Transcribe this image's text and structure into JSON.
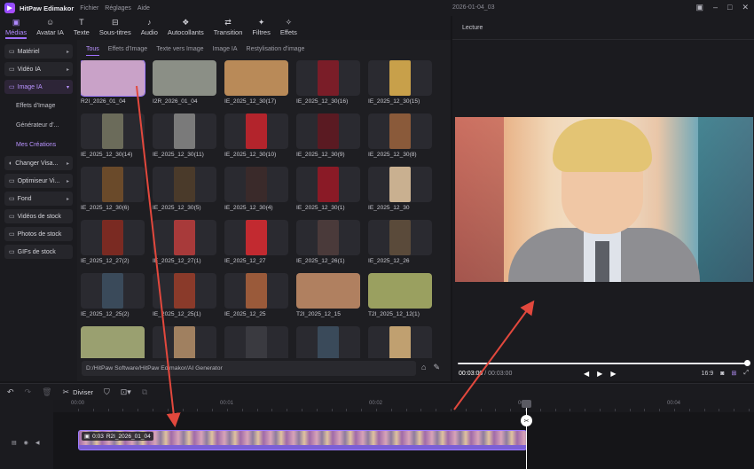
{
  "app": {
    "name": "HitPaw Edimakor",
    "menu": [
      "Fichier",
      "Réglages",
      "Aide"
    ],
    "project_title": "2026-01-04_03"
  },
  "toolbar": [
    {
      "label": "Médias",
      "icon": "media-icon",
      "glyph": "▣",
      "active": true
    },
    {
      "label": "Avatar IA",
      "icon": "avatar-icon",
      "glyph": "☺",
      "active": false
    },
    {
      "label": "Texte",
      "icon": "text-icon",
      "glyph": "T",
      "active": false
    },
    {
      "label": "Sous-titres",
      "icon": "subtitles-icon",
      "glyph": "⊟",
      "active": false
    },
    {
      "label": "Audio",
      "icon": "audio-icon",
      "glyph": "♪",
      "active": false
    },
    {
      "label": "Autocollants",
      "icon": "sticker-icon",
      "glyph": "❖",
      "active": false
    },
    {
      "label": "Transition",
      "icon": "transition-icon",
      "glyph": "⇄",
      "active": false
    },
    {
      "label": "Filtres",
      "icon": "filter-icon",
      "glyph": "✦",
      "active": false
    },
    {
      "label": "Effets",
      "icon": "effects-icon",
      "glyph": "✧",
      "active": false
    }
  ],
  "sidebar": {
    "groups": [
      {
        "label": "Matériel",
        "glyph": "▭",
        "active": false
      },
      {
        "label": "Vidéo IA",
        "glyph": "▭",
        "active": false
      },
      {
        "label": "Image IA",
        "glyph": "▭",
        "active": true
      }
    ],
    "sub_items": [
      {
        "label": "Effets d'Image",
        "active": false
      },
      {
        "label": "Générateur d'...",
        "active": false
      },
      {
        "label": "Mes Créations",
        "active": true
      }
    ],
    "more_groups": [
      {
        "label": "Changer Visa...",
        "glyph": "◐",
        "chev": true
      },
      {
        "label": "Optimiseur Vi...",
        "glyph": "▭",
        "chev": true
      },
      {
        "label": "Fond",
        "glyph": "▭",
        "chev": true
      },
      {
        "label": "Vidéos de stock",
        "glyph": "▭",
        "chev": false
      },
      {
        "label": "Photos de stock",
        "glyph": "▭",
        "chev": false
      },
      {
        "label": "GIFs de stock",
        "glyph": "▭",
        "chev": false
      }
    ]
  },
  "media": {
    "tabs": [
      {
        "label": "Tous",
        "active": true
      },
      {
        "label": "Effets d'Image",
        "active": false
      },
      {
        "label": "Texte vers Image",
        "active": false
      },
      {
        "label": "Image IA",
        "active": false
      },
      {
        "label": "Restylisation d'image",
        "active": false
      }
    ],
    "items": [
      {
        "name": "R2I_2026_01_04",
        "color": "#c9a2c8",
        "ratio": "wide",
        "selected": true
      },
      {
        "name": "I2R_2026_01_04",
        "color": "#8b8f86",
        "ratio": "wide",
        "selected": false
      },
      {
        "name": "IE_2025_12_30(17)",
        "color": "#b98a58",
        "ratio": "wide",
        "selected": false
      },
      {
        "name": "IE_2025_12_30(16)",
        "color": "#7a1d28",
        "ratio": "tall",
        "selected": false
      },
      {
        "name": "IE_2025_12_30(15)",
        "color": "#c8a04a",
        "ratio": "tall",
        "selected": false
      },
      {
        "name": "IE_2025_12_30(14)",
        "color": "#6b6b5a",
        "ratio": "tall",
        "selected": false
      },
      {
        "name": "IE_2025_12_30(11)",
        "color": "#7a7a7a",
        "ratio": "tall",
        "selected": false
      },
      {
        "name": "IE_2025_12_30(10)",
        "color": "#b3242c",
        "ratio": "tall",
        "selected": false
      },
      {
        "name": "IE_2025_12_30(9)",
        "color": "#5a1a22",
        "ratio": "tall",
        "selected": false
      },
      {
        "name": "IE_2025_12_30(8)",
        "color": "#8a5a3a",
        "ratio": "tall",
        "selected": false
      },
      {
        "name": "IE_2025_12_30(6)",
        "color": "#6a4a2a",
        "ratio": "tall",
        "selected": false
      },
      {
        "name": "IE_2025_12_30(5)",
        "color": "#4a3a2a",
        "ratio": "tall",
        "selected": false
      },
      {
        "name": "IE_2025_12_30(4)",
        "color": "#3a2a2a",
        "ratio": "tall",
        "selected": false
      },
      {
        "name": "IE_2025_12_30(1)",
        "color": "#8a1a26",
        "ratio": "tall",
        "selected": false
      },
      {
        "name": "IE_2025_12_30",
        "color": "#c9b090",
        "ratio": "tall",
        "selected": false
      },
      {
        "name": "IE_2025_12_27(2)",
        "color": "#7a2a22",
        "ratio": "tall",
        "selected": false
      },
      {
        "name": "IE_2025_12_27(1)",
        "color": "#a83a3a",
        "ratio": "tall",
        "selected": false
      },
      {
        "name": "IE_2025_12_27",
        "color": "#c22a30",
        "ratio": "tall",
        "selected": false
      },
      {
        "name": "IE_2025_12_26(1)",
        "color": "#4a3a3a",
        "ratio": "tall",
        "selected": false
      },
      {
        "name": "IE_2025_12_26",
        "color": "#5a4a3a",
        "ratio": "tall",
        "selected": false
      },
      {
        "name": "IE_2025_12_25(2)",
        "color": "#3a4a5a",
        "ratio": "tall",
        "selected": false
      },
      {
        "name": "IE_2025_12_25(1)",
        "color": "#8a3a2a",
        "ratio": "tall",
        "selected": false
      },
      {
        "name": "IE_2025_12_25",
        "color": "#9a5a3a",
        "ratio": "tall",
        "selected": false
      },
      {
        "name": "T2I_2025_12_15",
        "color": "#b08060",
        "ratio": "wide",
        "selected": false
      },
      {
        "name": "T2I_2025_12_12(1)",
        "color": "#9aa060",
        "ratio": "wide",
        "selected": false
      },
      {
        "name": "",
        "color": "#9aa070",
        "ratio": "wide",
        "selected": false
      },
      {
        "name": "",
        "color": "#a08060",
        "ratio": "tall",
        "selected": false
      },
      {
        "name": "",
        "color": "#3a3a40",
        "ratio": "tall",
        "selected": false
      },
      {
        "name": "",
        "color": "#3a4a5a",
        "ratio": "tall",
        "selected": false
      },
      {
        "name": "",
        "color": "#c0a070",
        "ratio": "tall",
        "selected": false
      }
    ],
    "path": "D:/HitPaw Software/HitPaw Edimakor/AI Generator"
  },
  "preview": {
    "header": "Lecture",
    "current_time": "00:03:00",
    "total_time": "/ 00:03:00",
    "aspect": "16:9",
    "progress": 1.0
  },
  "timeline": {
    "split_label": "Diviser",
    "ruler": [
      "00:00",
      "00:01",
      "00:02",
      "00:03",
      "00:04"
    ],
    "clip_duration": "0:03",
    "clip_name": "R2I_2026_01_04"
  },
  "colors": {
    "accent": "#a070ff",
    "annotation": "#e2483d"
  }
}
